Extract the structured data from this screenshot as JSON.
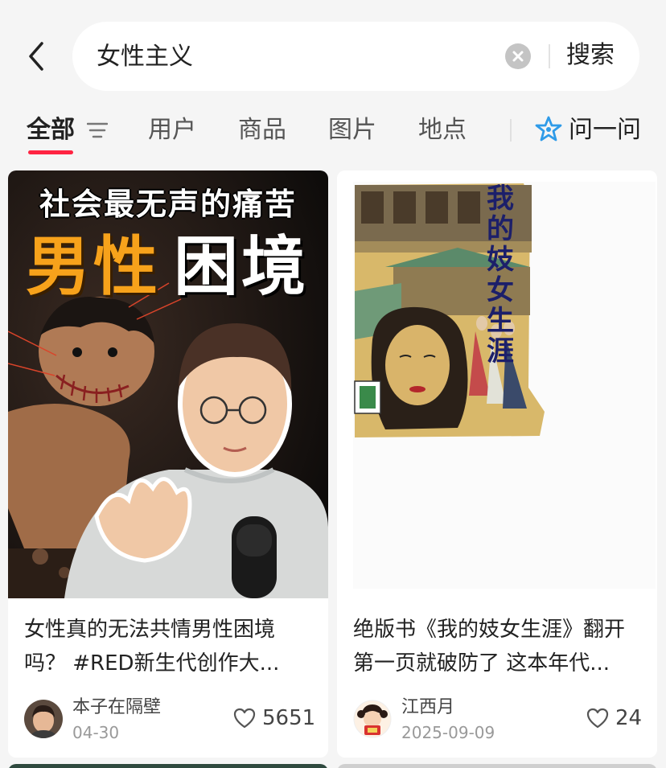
{
  "search": {
    "query": "女性主义",
    "button_label": "搜索"
  },
  "tabs": {
    "items": [
      "全部",
      "用户",
      "商品",
      "图片",
      "地点"
    ],
    "ask_label": "问一问"
  },
  "cards": [
    {
      "cover_headline": "社会最无声的痛苦",
      "cover_big_orange": "男性",
      "cover_big_white": "困境",
      "title_line1": "女性真的无法共情男性困境",
      "title_line2": "吗？ #RED新生代创作大...",
      "author": "本子在隔壁",
      "date": "04-30",
      "likes": "5651"
    },
    {
      "cover_vertical_title": "我的妓女生涯",
      "title_line1": "绝版书《我的妓女生涯》翻开",
      "title_line2": "第一页就破防了 这本年代...",
      "author": "江西月",
      "date": "2025-09-09",
      "likes": "24"
    }
  ],
  "colors": {
    "accent": "#ff2442",
    "ask_icon": "#2f9be8"
  }
}
